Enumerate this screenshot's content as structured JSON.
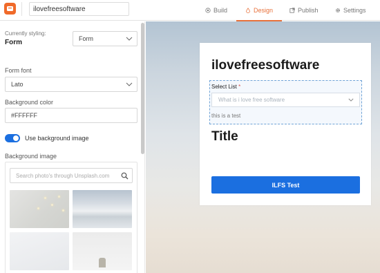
{
  "topbar": {
    "form_name": "ilovefreesoftware",
    "tabs": [
      {
        "label": "Build",
        "icon": "target-icon",
        "active": false
      },
      {
        "label": "Design",
        "icon": "droplet-icon",
        "active": true
      },
      {
        "label": "Publish",
        "icon": "external-link-icon",
        "active": false
      },
      {
        "label": "Settings",
        "icon": "gear-icon",
        "active": false
      }
    ],
    "accent_color": "#e8703a"
  },
  "panel": {
    "currently_styling_label": "Currently styling:",
    "currently_styling_value": "Form",
    "styling_select_value": "Form",
    "form_font_label": "Form font",
    "form_font_value": "Lato",
    "background_color_label": "Background color",
    "background_color_value": "#FFFFFF",
    "use_background_image_label": "Use background image",
    "use_background_image_on": true,
    "background_image_label": "Background image",
    "unsplash_placeholder": "Search photo's through Unsplash.com"
  },
  "preview": {
    "form_title": "ilovefreesoftware",
    "select_label": "Select List",
    "required_mark": "*",
    "select_placeholder": "What is i love free software",
    "help_text": "this is a test",
    "title_text": "Title",
    "submit_label": "ILFS Test",
    "button_color": "#1b6fe0"
  }
}
